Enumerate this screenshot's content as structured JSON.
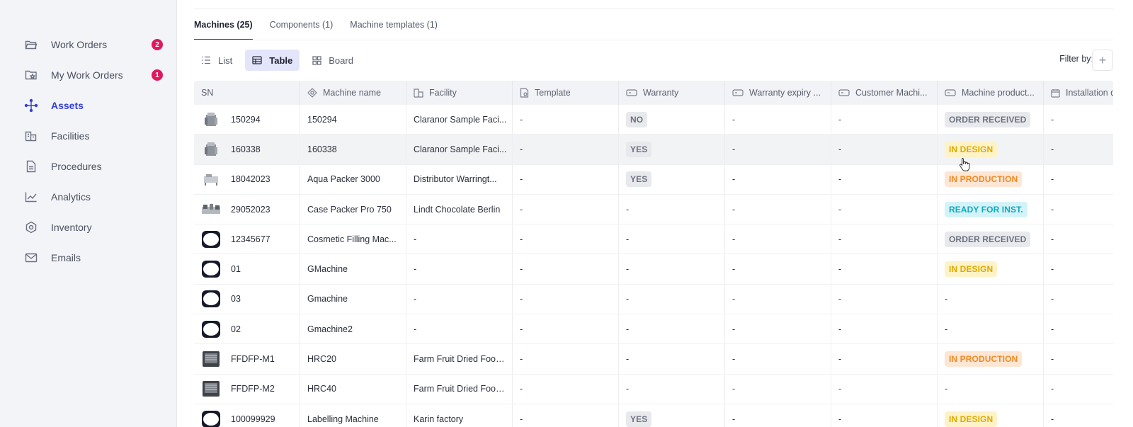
{
  "sidebar": {
    "items": [
      {
        "label": "Work Orders",
        "icon": "folder-open-icon",
        "badge": "2"
      },
      {
        "label": "My Work Orders",
        "icon": "folder-star-icon",
        "badge": "1"
      },
      {
        "label": "Assets",
        "icon": "assets-icon",
        "active": true
      },
      {
        "label": "Facilities",
        "icon": "building-icon"
      },
      {
        "label": "Procedures",
        "icon": "document-icon"
      },
      {
        "label": "Analytics",
        "icon": "chart-line-icon"
      },
      {
        "label": "Inventory",
        "icon": "hexagon-icon"
      },
      {
        "label": "Emails",
        "icon": "mail-icon"
      }
    ]
  },
  "tabs": [
    {
      "label": "Machines (25)",
      "active": true
    },
    {
      "label": "Components (1)"
    },
    {
      "label": "Machine templates (1)"
    }
  ],
  "views": {
    "list": "List",
    "table": "Table",
    "board": "Board"
  },
  "filter_label": "Filter by:",
  "add_filter": "+",
  "columns": [
    "SN",
    "Machine name",
    "Facility",
    "Template",
    "Warranty",
    "Warranty expiry ...",
    "Customer Machi...",
    "Machine product...",
    "Installation d"
  ],
  "rows": [
    {
      "sn": "150294",
      "name": "150294",
      "facility": "Claranor Sample Faci...",
      "template": "-",
      "warranty": "NO",
      "expiry": "-",
      "customer": "-",
      "status": "ORDER RECEIVED",
      "status_color": "gray",
      "install": "-",
      "thumb": "machine-photo"
    },
    {
      "sn": "160338",
      "name": "160338",
      "facility": "Claranor Sample Faci...",
      "template": "-",
      "warranty": "YES",
      "expiry": "-",
      "customer": "-",
      "status": "IN DESIGN",
      "status_color": "yellow",
      "install": "-",
      "thumb": "machine-photo"
    },
    {
      "sn": "18042023",
      "name": "Aqua Packer 3000",
      "facility": "Distributor Warringt...",
      "template": "-",
      "warranty": "YES",
      "expiry": "-",
      "customer": "-",
      "status": "IN PRODUCTION",
      "status_color": "orange",
      "install": "-",
      "thumb": "packer-photo"
    },
    {
      "sn": "29052023",
      "name": "Case Packer Pro 750",
      "facility": "Lindt Chocolate Berlin",
      "template": "-",
      "warranty": "-",
      "expiry": "-",
      "customer": "-",
      "status": "READY FOR INST.",
      "status_color": "cyan",
      "install": "-",
      "thumb": "line-photo"
    },
    {
      "sn": "12345677",
      "name": "Cosmetic Filling Mac...",
      "facility": "-",
      "template": "-",
      "warranty": "-",
      "expiry": "-",
      "customer": "-",
      "status": "ORDER RECEIVED",
      "status_color": "gray",
      "install": "-",
      "thumb": "placeholder"
    },
    {
      "sn": "01",
      "name": "GMachine",
      "facility": "-",
      "template": "-",
      "warranty": "-",
      "expiry": "-",
      "customer": "-",
      "status": "IN DESIGN",
      "status_color": "yellow",
      "install": "-",
      "thumb": "placeholder"
    },
    {
      "sn": "03",
      "name": "Gmachine",
      "facility": "-",
      "template": "-",
      "warranty": "-",
      "expiry": "-",
      "customer": "-",
      "status": "-",
      "status_color": "",
      "install": "-",
      "thumb": "placeholder"
    },
    {
      "sn": "02",
      "name": "Gmachine2",
      "facility": "-",
      "template": "-",
      "warranty": "-",
      "expiry": "-",
      "customer": "-",
      "status": "-",
      "status_color": "",
      "install": "-",
      "thumb": "placeholder"
    },
    {
      "sn": "FFDFP-M1",
      "name": "HRC20",
      "facility": "Farm Fruit Dried Food...",
      "template": "-",
      "warranty": "-",
      "expiry": "-",
      "customer": "-",
      "status": "IN PRODUCTION",
      "status_color": "orange",
      "install": "-",
      "thumb": "dryer-photo"
    },
    {
      "sn": "FFDFP-M2",
      "name": "HRC40",
      "facility": "Farm Fruit Dried Food...",
      "template": "-",
      "warranty": "-",
      "expiry": "-",
      "customer": "-",
      "status": "-",
      "status_color": "",
      "install": "-",
      "thumb": "dryer-photo"
    },
    {
      "sn": "100099929",
      "name": "Labelling Machine",
      "facility": "Karin factory",
      "template": "-",
      "warranty": "YES",
      "expiry": "-",
      "customer": "-",
      "status": "IN DESIGN",
      "status_color": "yellow",
      "install": "-",
      "thumb": "placeholder"
    }
  ]
}
